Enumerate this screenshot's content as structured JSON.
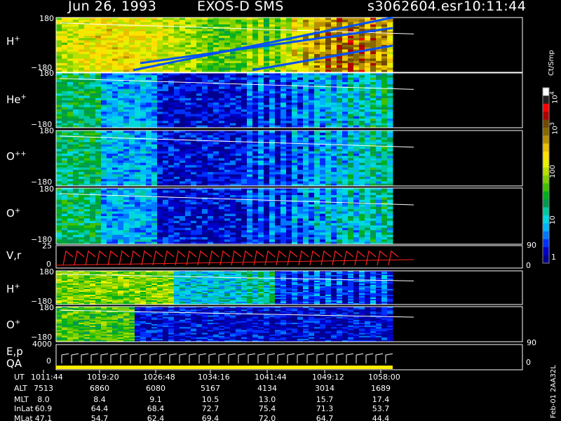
{
  "header": {
    "date": "Jun 26, 1993",
    "instrument": "EXOS-D SMS",
    "filename": "s3062604.esr",
    "time": "10:11:44"
  },
  "colors": {
    "background": "#000000",
    "trace_white": "#ffffff",
    "trace_red": "#ff2020",
    "qa_bar": "#ffee00"
  },
  "panels": [
    {
      "id": "h1",
      "label": "H",
      "sup": "+",
      "ymax": "180",
      "ymin": "−180"
    },
    {
      "id": "he1",
      "label": "He",
      "sup": "+",
      "ymax": "180",
      "ymin": "−180"
    },
    {
      "id": "opp1",
      "label": "O",
      "sup": "++",
      "ymax": "180",
      "ymin": "−180"
    },
    {
      "id": "op1",
      "label": "O",
      "sup": "+",
      "ymax": "180",
      "ymin": "−180"
    },
    {
      "id": "vr",
      "label": "V,r",
      "ymax": "25",
      "ymin": "0",
      "right_max": "90",
      "right_min": "0"
    },
    {
      "id": "h2",
      "label": "H",
      "sup": "+",
      "ymax": "180",
      "ymin": "−180"
    },
    {
      "id": "op2",
      "label": "O",
      "sup": "+",
      "ymax": "180",
      "ymin": "−180"
    },
    {
      "id": "ep",
      "label": "E,p",
      "label2": "QA",
      "ymax": "4000",
      "ymin": "0",
      "right_max": "90",
      "right_min": "0"
    }
  ],
  "colorbar": {
    "unit": "Ct/Smp",
    "ticks": [
      {
        "label": "1",
        "exp": ""
      },
      {
        "label": "10",
        "exp": ""
      },
      {
        "label": "100",
        "exp": ""
      },
      {
        "label": "10",
        "exp": "3"
      },
      {
        "label": "10",
        "exp": "4"
      }
    ],
    "colors": [
      "#000090",
      "#0000c8",
      "#0030ff",
      "#0078ff",
      "#00b4ff",
      "#00d8e0",
      "#00c8a0",
      "#009a50",
      "#00b020",
      "#40c000",
      "#80d000",
      "#b8e000",
      "#e8f000",
      "#ffe000",
      "#e8c000",
      "#b89000",
      "#886800",
      "#704800",
      "#b00000",
      "#ff0000",
      "#202020",
      "#ffffff"
    ]
  },
  "table": {
    "headers": [
      "UT",
      "ALT",
      "MLT",
      "InLat",
      "MLat"
    ],
    "rows": [
      [
        "1011:44",
        "1019:20",
        "1026:48",
        "1034:16",
        "1041:44",
        "1049:12",
        "1058:00"
      ],
      [
        "7513",
        "6860",
        "6080",
        "5167",
        "4134",
        "3014",
        "1689"
      ],
      [
        "8.0",
        "8.4",
        "9.1",
        "10.5",
        "13.0",
        "15.7",
        "17.4"
      ],
      [
        "60.9",
        "64.4",
        "68.4",
        "72.7",
        "75.4",
        "71.3",
        "53.7"
      ],
      [
        "47.1",
        "54.7",
        "62.4",
        "69.4",
        "72.0",
        "64.7",
        "44.4"
      ]
    ]
  },
  "footer": "Feb-01 2AA32L",
  "chart_data": {
    "type": "heatmap",
    "title": "Jun 26, 1993   EXOS-D SMS",
    "x_ticks": [
      "1011:44",
      "1019:20",
      "1026:48",
      "1034:16",
      "1041:44",
      "1049:12",
      "1058:00"
    ],
    "y_range_angle": [
      -180,
      180
    ],
    "panels": [
      "H+",
      "He+",
      "O++",
      "O+",
      "V,r",
      "H+",
      "O+",
      "E,p"
    ],
    "colorbar_unit": "Ct/Smp",
    "colorbar_range": [
      1,
      10000
    ],
    "log_color_scale": true
  }
}
